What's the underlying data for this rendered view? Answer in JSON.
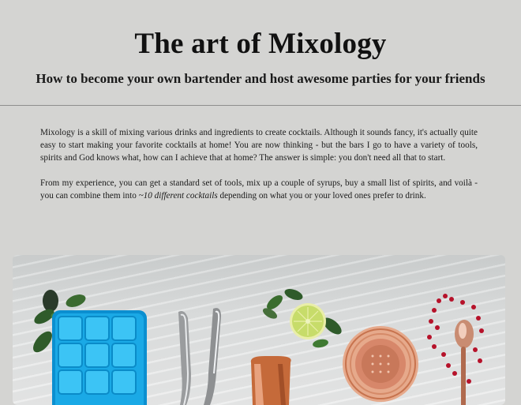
{
  "header": {
    "title": "The art of Mixology",
    "subtitle": "How to become your own bartender and host awesome parties for your friends"
  },
  "content": {
    "p1": "Mixology is a skill of mixing various drinks and ingredients to create cocktails. Although it sounds fancy, it's actually quite easy to start making your favorite cocktails at home! You are now thinking - but the bars I go to have a variety of tools, spirits and God knows what, how can I achieve that at home? The answer is simple: you don't need all that to start.",
    "p2_before": "From my experience, you can get a standard set of tools, mix up a couple of syrups, buy a small list of spirits, and voilà - you can combine them into ",
    "p2_em": "~10 different cocktails",
    "p2_after": " depending on what you or your loved ones prefer to drink."
  },
  "image": {
    "icons": [
      "ice-tray-icon",
      "bar-tongs-icon",
      "shaker-icon",
      "lime-icon",
      "strainer-icon",
      "bar-spoon-icon"
    ]
  }
}
